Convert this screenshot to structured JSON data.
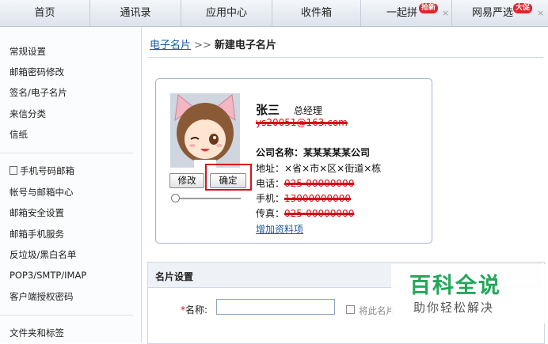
{
  "tabs": [
    {
      "label": "首页"
    },
    {
      "label": "通讯录"
    },
    {
      "label": "应用中心"
    },
    {
      "label": "收件箱"
    },
    {
      "label": "一起拼",
      "badge": "抢新",
      "close": "×"
    },
    {
      "label": "网易严选",
      "badge": "大促",
      "close": "×"
    }
  ],
  "sidebar": {
    "group1": [
      "常规设置",
      "邮箱密码修改",
      "签名/电子名片",
      "来信分类",
      "信纸"
    ],
    "group2": [
      "手机号码邮箱",
      "帐号与邮箱中心",
      "邮箱安全设置",
      "邮箱手机服务",
      "反垃圾/黑白名单",
      "POP3/SMTP/IMAP",
      "客户端授权密码"
    ],
    "group3": [
      "文件夹和标签"
    ]
  },
  "breadcrumb": {
    "link": "电子名片",
    "separator": ">>",
    "current": "新建电子名片"
  },
  "card": {
    "name": "张三",
    "title": "总经理",
    "email": "ys20051@163.com",
    "company_label": "公司名称：",
    "company": "某某某某某公司",
    "address_label": "地址：",
    "address": "×省×市×区×街道×栋",
    "phone_label": "电话：",
    "phone": "025-00000000",
    "mobile_label": "手机：",
    "mobile": "13000000000",
    "fax_label": "传真：",
    "fax": "025-00000000",
    "add_info_link": "增加资料项",
    "edit_button": "修改",
    "confirm_button": "确定"
  },
  "settings": {
    "section_title": "名片设置",
    "name_required": "*",
    "name_label": "名称:",
    "name_value": "",
    "checkbox_label": "将此名片"
  },
  "watermark": {
    "logo": "百科全说",
    "tagline": "助你轻松解决"
  },
  "colors": {
    "accent_blue": "#1d5aa6",
    "highlight_red": "#d9111c",
    "watermark_green": "#23a65b",
    "badge_red": "#e0262b"
  }
}
